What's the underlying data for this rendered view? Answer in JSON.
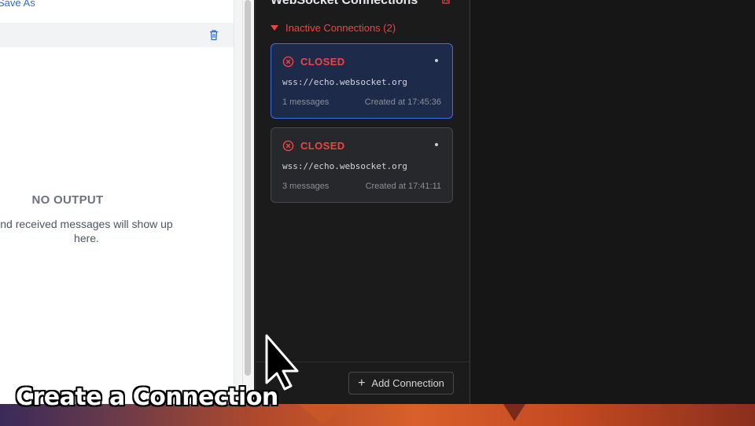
{
  "left_pane": {
    "save_as_label": "Save As",
    "no_output_title": "NO OUTPUT",
    "no_output_description": "nd received messages will show up here."
  },
  "ws_panel": {
    "title": "WebSocket Connections",
    "inactive_header": "Inactive Connections (2)",
    "connections": [
      {
        "status": "CLOSED",
        "url": "wss://echo.websocket.org",
        "messages": "1 messages",
        "created": "Created at 17:45:36",
        "selected": true
      },
      {
        "status": "CLOSED",
        "url": "wss://echo.websocket.org",
        "messages": "3 messages",
        "created": "Created at 17:41:11",
        "selected": false
      }
    ],
    "add_button_label": "Add Connection"
  },
  "caption": "Create a Connection",
  "colors": {
    "accent_blue": "#3b6fe0",
    "status_red": "#ef4444",
    "link_blue": "#2a6bd6"
  },
  "icons": [
    "trash-icon",
    "x-circle-icon",
    "more-icon",
    "plus-icon",
    "caret-down-icon",
    "mouse-pointer-icon"
  ]
}
